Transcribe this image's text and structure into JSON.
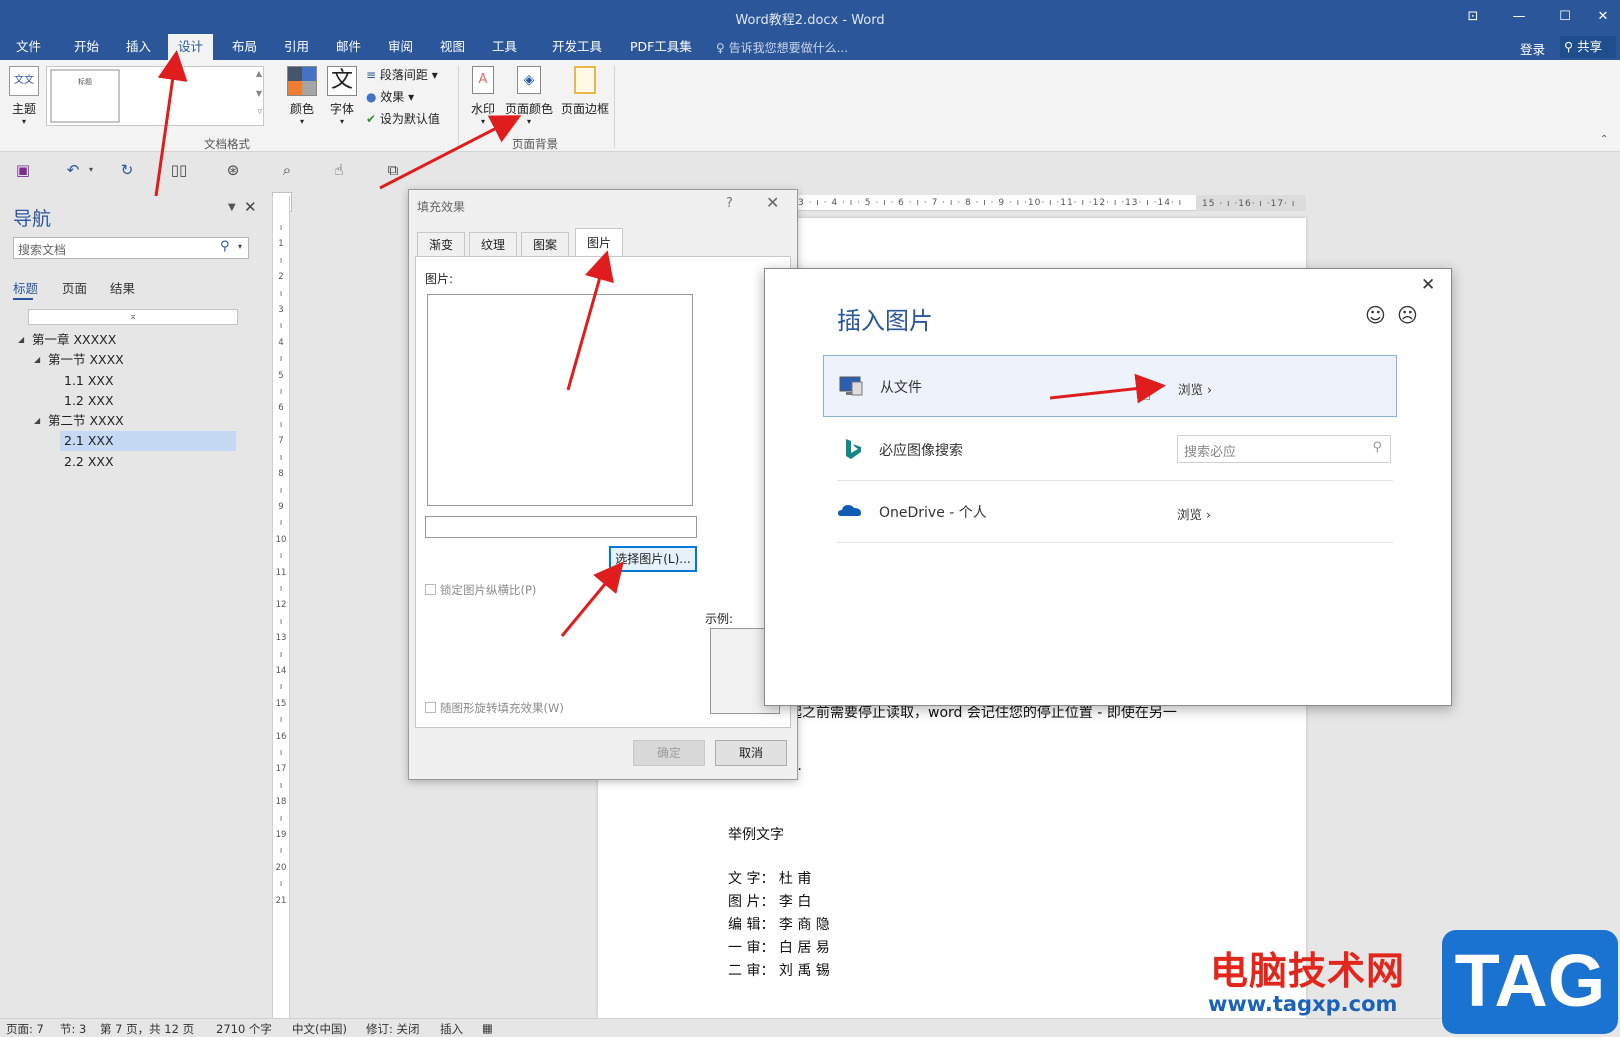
{
  "window": {
    "title": "Word教程2.docx - Word",
    "controls": [
      "⊡",
      "—",
      "☐",
      "✕"
    ]
  },
  "tabs": [
    "文件",
    "开始",
    "插入",
    "设计",
    "布局",
    "引用",
    "邮件",
    "审阅",
    "视图",
    "工具",
    "开发工具",
    "PDF工具集"
  ],
  "tellme": "告诉我您想要做什么...",
  "login": "登录",
  "share": "共享",
  "ribbon": {
    "theme": "主题",
    "gallery_thumb": "标题",
    "colors": "颜色",
    "fonts": "字体",
    "font_glyph": "文",
    "paragraph_spacing": "段落间距",
    "effects": "效果",
    "set_default": "设为默认值",
    "group_doc_format": "文档格式",
    "watermark": "水印",
    "page_color": "页面颜色",
    "page_borders": "页面边框",
    "group_page_bg": "页面背景"
  },
  "nav": {
    "title": "导航",
    "search_placeholder": "搜索文档",
    "tabs": [
      "标题",
      "页面",
      "结果"
    ],
    "items": [
      "第一章 XXXXX",
      "第一节 XXXX",
      "1.1 XXX",
      "1.2 XXX",
      "第二节 XXXX",
      "2.1 XXX",
      "2.2 XXX"
    ]
  },
  "ruler": {
    "h": "3 · ı · 4 · ı · 5 · ı · 6 · ı · 7 · ı · 8 · ı · 9 · ı ·10· ı ·11· ı ·12· ı ·13· ı ·14· ı",
    "h_tail": "15 · ı ·16· ı ·17· ı",
    "v": [
      "ı",
      "1",
      "ı",
      "2",
      "ı",
      "3",
      "ı",
      "4",
      "ı",
      "5",
      "ı",
      "6",
      "ı",
      "7",
      "ı",
      "8",
      "ı",
      "9",
      "ı",
      "10",
      "ı",
      "11",
      "ı",
      "12",
      "ı",
      "13",
      "ı",
      "14",
      "ı",
      "15",
      "ı",
      "16",
      "ı",
      "17",
      "ı",
      "18",
      "ı",
      "19",
      "ı",
      "20",
      "ı",
      "21"
    ]
  },
  "document": {
    "partial_line": "起之前需要停止读取，word 会记住您的停止位置 - 即使在另一",
    "ellipsis": "…",
    "example_heading": "举例文字",
    "credits": [
      "文 字： 杜 甫",
      "图 片： 李 白",
      "编 辑： 李 商 隐",
      "一 审： 白 居 易",
      "二 审： 刘 禹 锡"
    ]
  },
  "fill_dialog": {
    "title": "填充效果",
    "help": "?",
    "close": "✕",
    "tabs": [
      "渐变",
      "纹理",
      "图案",
      "图片"
    ],
    "picture_label": "图片:",
    "select_button": "选择图片(L)...",
    "lock_ratio": "锁定图片纵横比(P)",
    "rotate_with_shape": "随图形旋转填充效果(W)",
    "sample_label": "示例:",
    "ok": "确定",
    "cancel": "取消"
  },
  "insert_dialog": {
    "title": "插入图片",
    "close": "✕",
    "rows": [
      {
        "label": "从文件",
        "browse": "浏览 ›"
      },
      {
        "label": "必应图像搜索",
        "search_placeholder": "搜索必应"
      },
      {
        "label": "OneDrive - 个人",
        "browse": "浏览 ›"
      }
    ]
  },
  "status": [
    "页面: 7",
    "节: 3",
    "第 7 页，共 12 页",
    "2710 个字",
    "中文(中国)",
    "修订: 关闭",
    "插入"
  ],
  "watermark": {
    "text": "电脑技术网",
    "url": "www.tagxp.com",
    "tag": "TAG"
  },
  "colors": {
    "accent": "#2b579a",
    "arrow": "#e01d1d"
  }
}
